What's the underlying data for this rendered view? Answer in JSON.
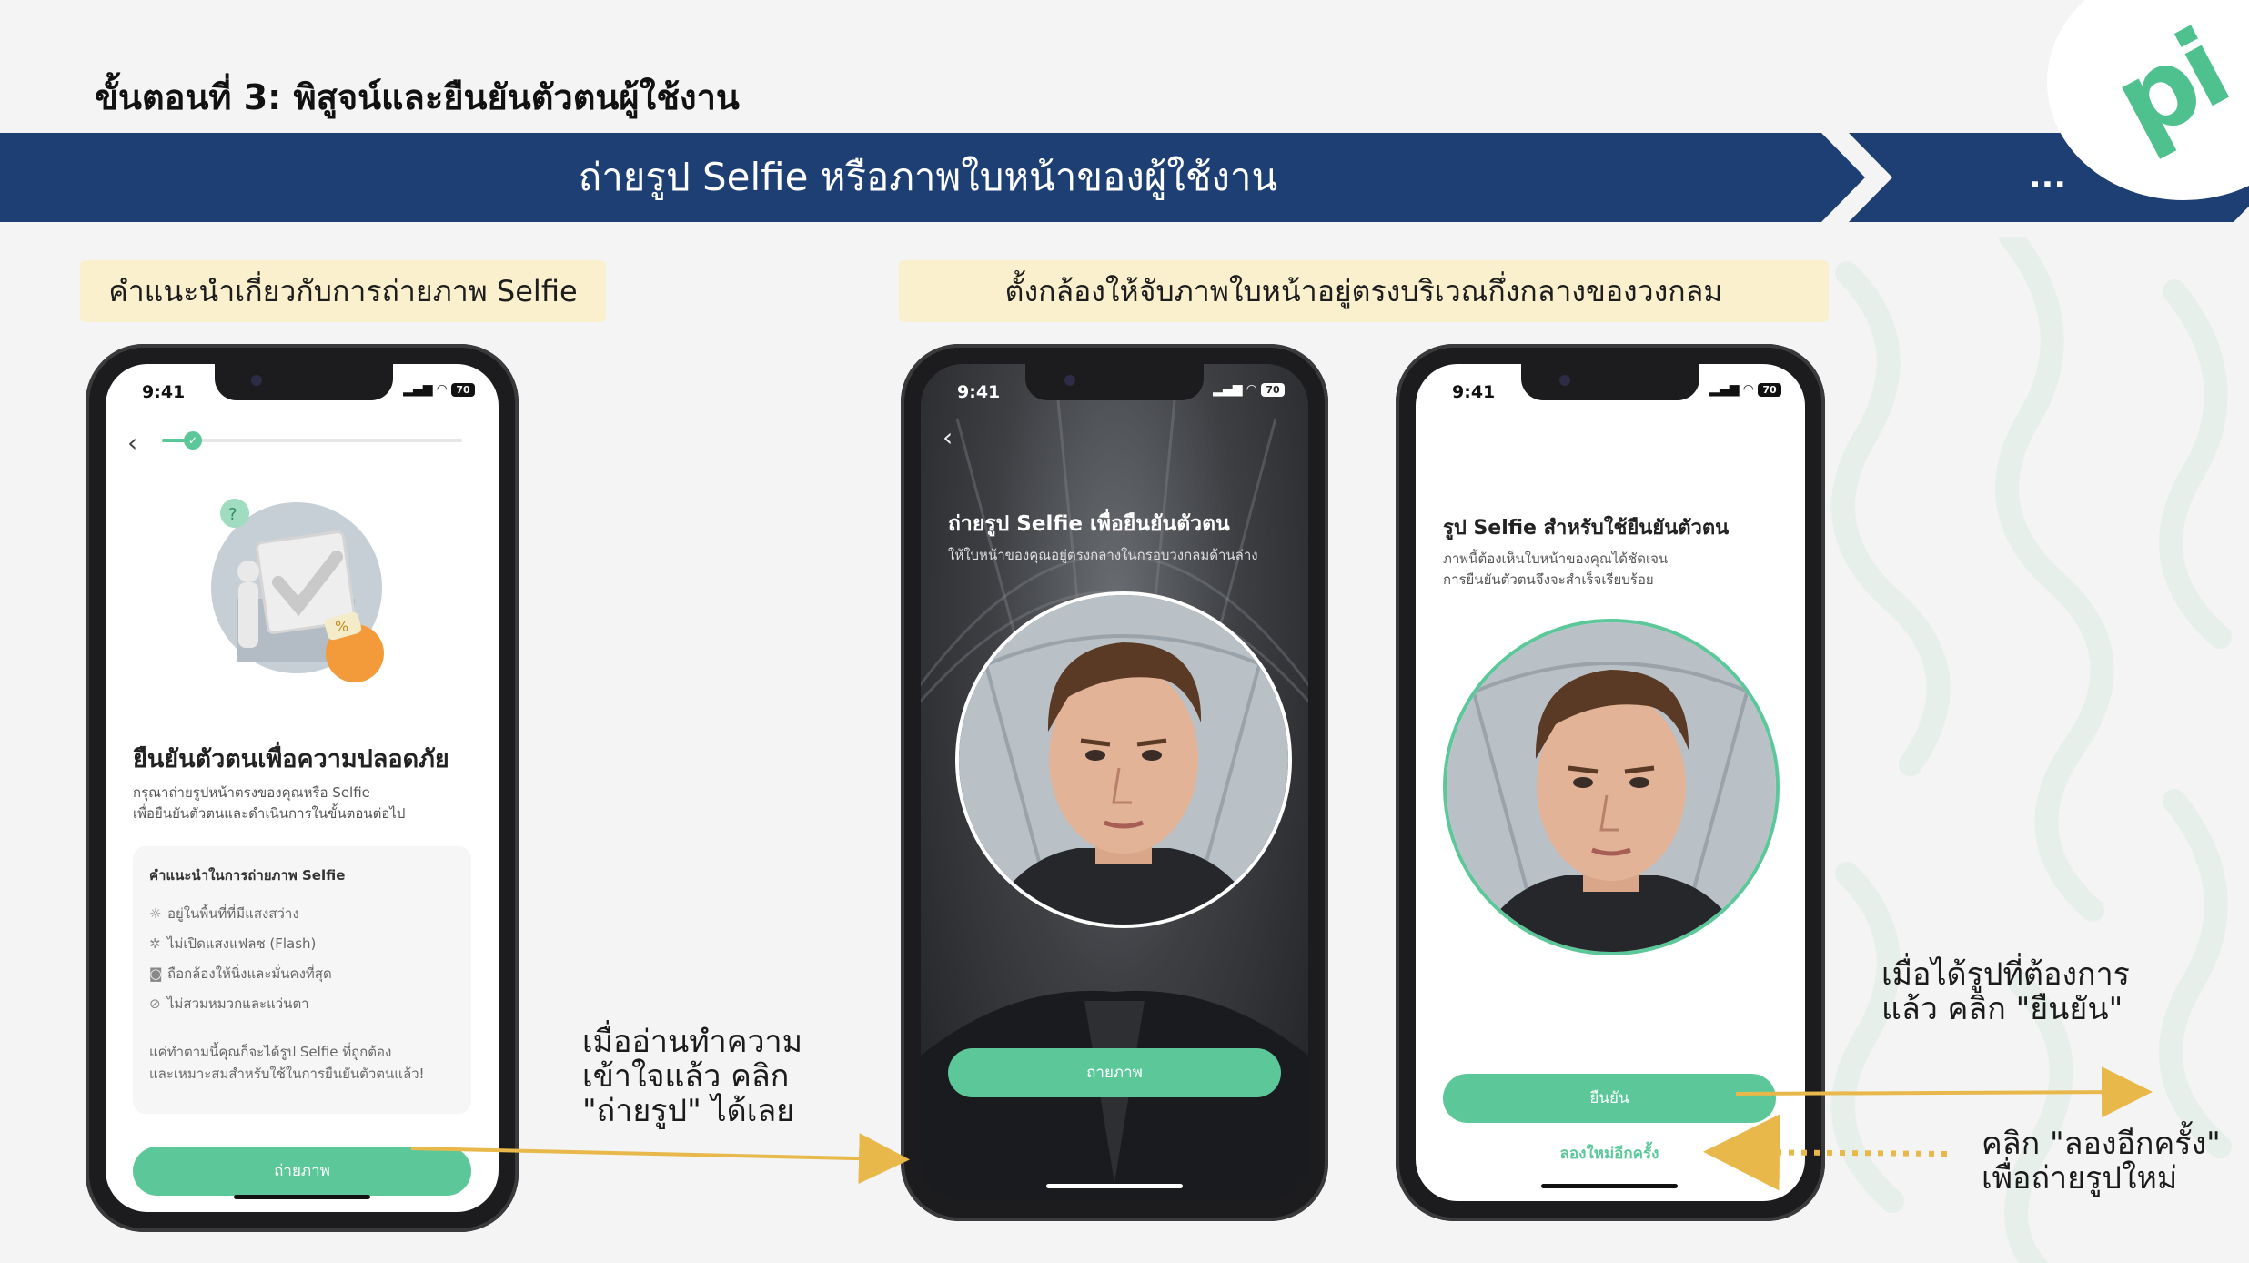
{
  "header": {
    "step_title": "ขั้นตอนที่ 3: พิสูจน์และยืนยันตัวตนผู้ใช้งาน",
    "banner_text": "ถ่ายรูป Selfie หรือภาพใบหน้าของผู้ใช้งาน",
    "banner_more": "...",
    "logo": "pi"
  },
  "tags": {
    "left": "คำแนะนำเกี่ยวกับการถ่ายภาพ Selfie",
    "middle": "ตั้งกล้องให้จับภาพใบหน้าอยู่ตรงบริเวณกึ่งกลางของวงกลม"
  },
  "status_bar": {
    "time": "9:41",
    "battery": "70"
  },
  "phone1": {
    "title": "ยืนยันตัวตนเพื่อความปลอดภัย",
    "subtitle_line1": "กรุณาถ่ายรูปหน้าตรงของคุณหรือ Selfie",
    "subtitle_line2": "เพื่อยืนยันตัวตนและดำเนินการในขั้นตอนต่อไป",
    "card_title": "คำแนะนำในการถ่ายภาพ Selfie",
    "tips": [
      {
        "icon": "sun-icon",
        "text": "อยู่ในพื้นที่ที่มีแสงสว่าง"
      },
      {
        "icon": "flash-off-icon",
        "text": "ไม่เปิดแสงแฟลช (Flash)"
      },
      {
        "icon": "camera-icon",
        "text": "ถือกล้องให้นิ่งและมั่นคงที่สุด"
      },
      {
        "icon": "no-glasses-icon",
        "text": "ไม่สวมหมวกและแว่นตา"
      }
    ],
    "footer_line1": "แค่ทำตามนี้คุณก็จะได้รูป Selfie ที่ถูกต้อง",
    "footer_line2": "และเหมาะสมสำหรับใช้ในการยืนยันตัวตนแล้ว!",
    "button": "ถ่ายภาพ"
  },
  "phone2": {
    "title": "ถ่ายรูป Selfie เพื่อยืนยันตัวตน",
    "subtitle": "ให้ใบหน้าของคุณอยู่ตรงกลางในกรอบวงกลมด้านล่าง",
    "button": "ถ่ายภาพ"
  },
  "phone3": {
    "title": "รูป Selfie สำหรับใช้ยืนยันตัวตน",
    "subtitle_line1": "ภาพนี้ต้องเห็นใบหน้าของคุณได้ชัดเจน",
    "subtitle_line2": "การยืนยันตัวตนจึงจะสำเร็จเรียบร้อย",
    "confirm_button": "ยืนยัน",
    "retry_link": "ลองใหม่อีกครั้ง"
  },
  "notes": {
    "note1_line1": "เมื่ออ่านทำความ",
    "note1_line2": "เข้าใจแล้ว คลิก",
    "note1_line3": "\"ถ่ายรูป\" ได้เลย",
    "note2_line1": "เมื่อได้รูปที่ต้องการ",
    "note2_line2": "แล้ว คลิก \"ยืนยัน\"",
    "note3_line1": "คลิก \"ลองอีกครั้ง\"",
    "note3_line2": "เพื่อถ่ายรูปใหม่"
  },
  "colors": {
    "banner": "#1d3f73",
    "accent_green": "#5cc89a",
    "arrow": "#e8b84a",
    "tag_bg": "#fbf0cd"
  }
}
